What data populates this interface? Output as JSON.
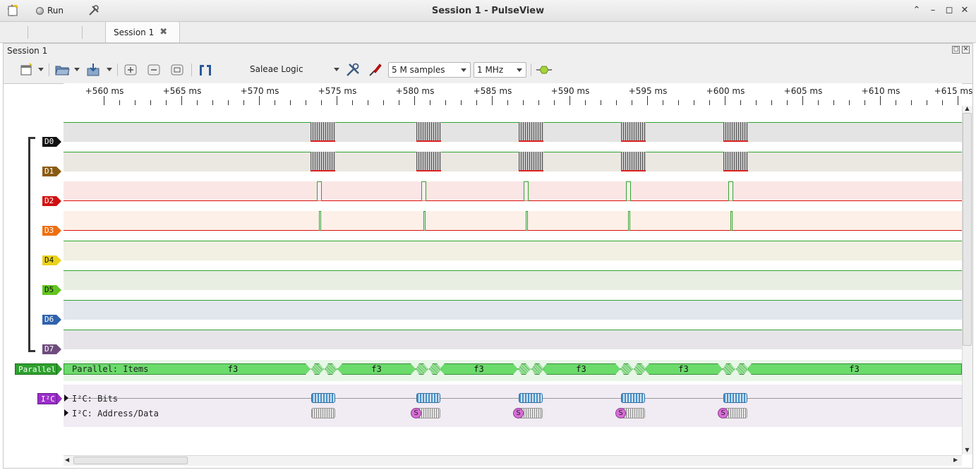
{
  "window": {
    "title": "Session 1 - PulseView",
    "buttons": [
      "minimize",
      "restore",
      "maximize",
      "close"
    ]
  },
  "tabbar": {
    "run_label": "Run",
    "session_tab_label": "Session 1"
  },
  "dock": {
    "title": "Session 1"
  },
  "toolbar": {
    "device": "Saleae Logic",
    "sample_count": "5 M samples",
    "sample_rate": "1 MHz"
  },
  "ruler": {
    "ticks": [
      "+560 ms",
      "+565 ms",
      "+570 ms",
      "+575 ms",
      "+580 ms",
      "+585 ms",
      "+590 ms",
      "+595 ms",
      "+600 ms",
      "+605 ms",
      "+610 ms",
      "+615 ms"
    ]
  },
  "channels": [
    {
      "label": "D0",
      "color": "#111111",
      "bg": "#e4e4e4"
    },
    {
      "label": "D1",
      "color": "#8b5a12",
      "bg": "#ebe8e2"
    },
    {
      "label": "D2",
      "color": "#d01010",
      "bg": "#fbe6e6"
    },
    {
      "label": "D3",
      "color": "#ee6f10",
      "bg": "#fdf0e8"
    },
    {
      "label": "D4",
      "color": "#ebd21a",
      "bg": "#f1f0e2"
    },
    {
      "label": "D5",
      "color": "#62c51f",
      "bg": "#e8efe2"
    },
    {
      "label": "D6",
      "color": "#2f63ad",
      "bg": "#e2e6ed"
    },
    {
      "label": "D7",
      "color": "#6e4c7e",
      "bg": "#e6e4e8"
    }
  ],
  "decoders": {
    "parallel": {
      "label": "Parallel",
      "row_label": "Parallel: Items",
      "value": "f3",
      "color": "#2ea12e"
    },
    "i2c": {
      "label": "I²C",
      "bits_row": "I²C: Bits",
      "addr_row": "I²C: Address/Data",
      "start_symbol": "S",
      "color": "#9a2fc9"
    }
  }
}
